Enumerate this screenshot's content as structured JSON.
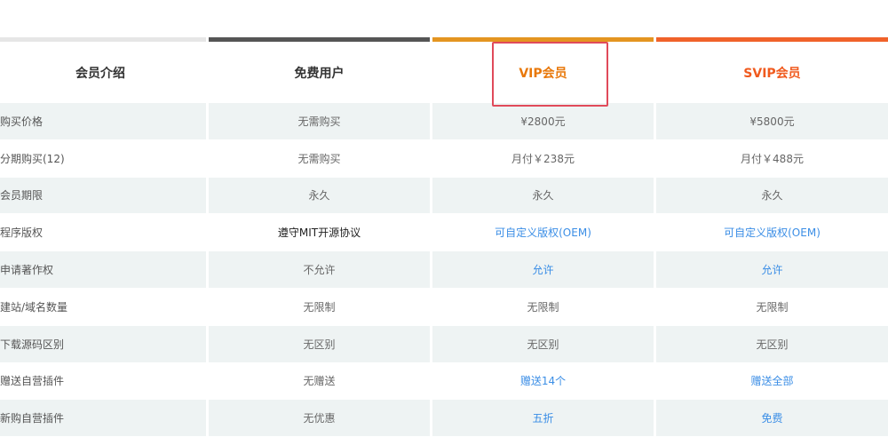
{
  "colors": {
    "bar_intro": "#e6e6e6",
    "bar_free": "#555555",
    "bar_vip": "#e49521",
    "bar_svip": "#f0622a",
    "highlight": "#e04a5a"
  },
  "header": {
    "intro": "会员介绍",
    "free": "免费用户",
    "vip": "VIP会员",
    "svip": "SVIP会员"
  },
  "rows": [
    {
      "label": "购买价格",
      "free": "无需购买",
      "vip": "¥2800元",
      "svip": "¥5800元"
    },
    {
      "label": "分期购买(12)",
      "free": "无需购买",
      "vip": "月付￥238元",
      "svip": "月付￥488元"
    },
    {
      "label": "会员期限",
      "free": "永久",
      "vip": "永久",
      "svip": "永久"
    },
    {
      "label": "程序版权",
      "free": "遵守MIT开源协议",
      "vip": "可自定义版权(OEM)",
      "svip": "可自定义版权(OEM)"
    },
    {
      "label": "申请著作权",
      "free": "不允许",
      "vip": "允许",
      "svip": "允许"
    },
    {
      "label": "建站/域名数量",
      "free": "无限制",
      "vip": "无限制",
      "svip": "无限制"
    },
    {
      "label": "下载源码区别",
      "free": "无区别",
      "vip": "无区别",
      "svip": "无区别"
    },
    {
      "label": "赠送自营插件",
      "free": "无赠送",
      "vip": "赠送14个",
      "svip": "赠送全部"
    },
    {
      "label": "新购自营插件",
      "free": "无优惠",
      "vip": "五折",
      "svip": "免费"
    }
  ]
}
